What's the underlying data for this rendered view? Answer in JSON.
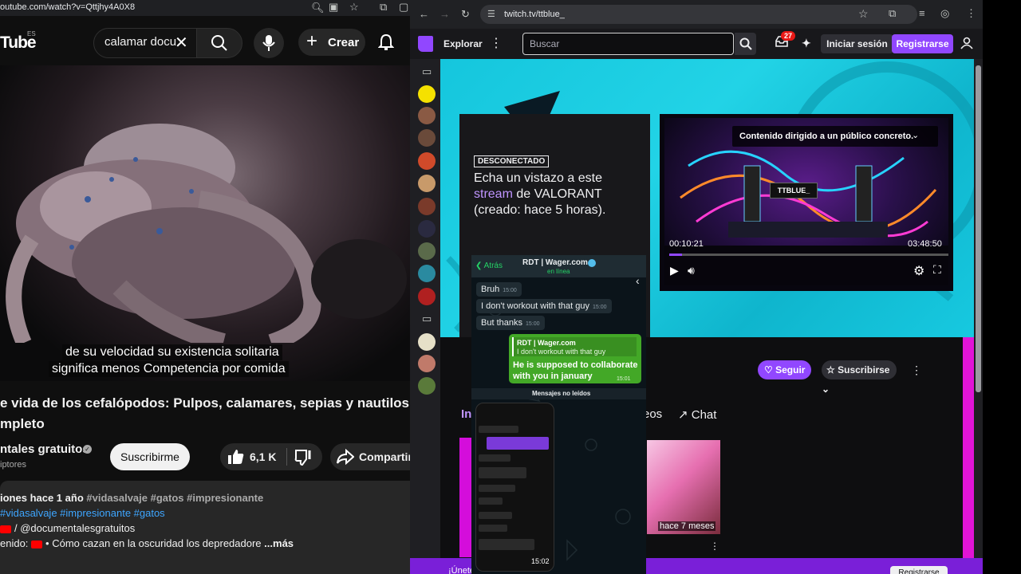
{
  "youtube": {
    "url": "outube.com/watch?v=Qttjhy4A0X8",
    "logo": "Tube",
    "region": "ES",
    "search_value": "calamar docu",
    "create_label": "Crear",
    "captions": [
      "de su velocidad su existencia solitaria",
      "significa menos Competencia por comida"
    ],
    "title_line1": "e vida de los cefalópodos: Pulpos, calamares, sepias y nautilos",
    "title_line2": "mpleto",
    "channel": "ntales gratuitos",
    "subscribers": "iptores",
    "subscribe_label": "Suscribirme",
    "likes": "6,1 K",
    "share_label": "Compartir",
    "desc_meta": "iones  hace 1 año",
    "desc_meta_tags": "#vidasalvaje #gatos #impresionante",
    "desc_tags": "#vidasalvaje #impresionante #gatos",
    "desc_channel_link": "/ @documentalesgratuitos",
    "desc_content_prefix": "enido:",
    "desc_content_text": "• Cómo cazan en la oscuridad los depredadore",
    "desc_more": "...más"
  },
  "twitch": {
    "url": "twitch.tv/ttblue_",
    "explore_label": "Explorar",
    "search_placeholder": "Buscar",
    "inbox_badge": "27",
    "login_label": "Iniciar sesión",
    "signup_label": "Registrarse",
    "offline_badge": "DESCONECTADO",
    "offline_line1": "Echa un vistazo a este",
    "offline_highlight": "stream",
    "offline_line2": " de VALORANT",
    "offline_line3": "(creado: hace 5 horas).",
    "player_notice": "Contenido dirigido a un público concreto.",
    "player_channel": "TTBLUE_",
    "time_current": "00:10:21",
    "time_total": "03:48:50",
    "progress": 0.045,
    "follow_label": "Seguir",
    "subscribe_label": "Suscribirse",
    "tab_active": "In",
    "tab_videos": "eos",
    "tab_chat": "Chat",
    "thumb_caption": "hace 7 meses",
    "bottom_text": "¡Únete",
    "bottom_button": "Registrarse",
    "accent": "#9147ff"
  },
  "whatsapp": {
    "back_label": "Atrás",
    "contact_name": "RDT | Wager.com",
    "status": "en línea",
    "messages": [
      {
        "text": "Bruh",
        "time": "15:00"
      },
      {
        "text": "I don't workout with that guy",
        "time": "15:00"
      },
      {
        "text": "But thanks",
        "time": "15:00"
      }
    ],
    "reply_quote_name": "RDT | Wager.com",
    "reply_quote_text": "I don't workout with that guy",
    "reply_text": "He is supposed to collaborate with you in january",
    "reply_time": "15:01",
    "unread_label": "Mensajes no leídos",
    "phone_time": "15:02"
  }
}
